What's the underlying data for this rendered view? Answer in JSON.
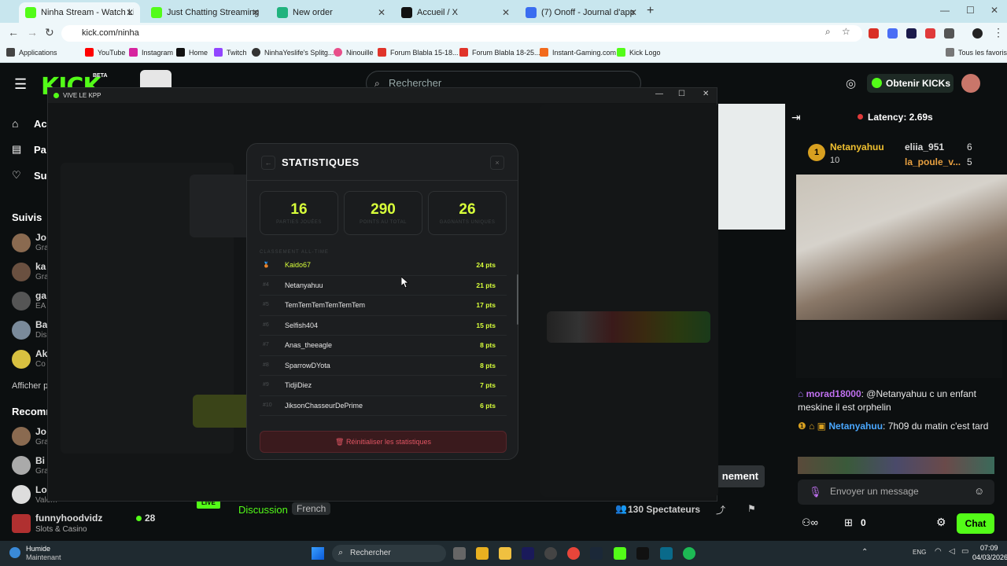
{
  "browser": {
    "tabs": [
      {
        "label": "Ninha Stream - Watch Live on K",
        "color": "#53fc18"
      },
      {
        "label": "Just Chatting Streaming - Live S",
        "color": "#53fc18"
      },
      {
        "label": "New order",
        "color": "#21b37e"
      },
      {
        "label": "Accueil / X",
        "color": "#111111"
      },
      {
        "label": "(7) Onoff - Journal d'appel",
        "color": "#3a6df0"
      }
    ],
    "url": "kick.com/ninha",
    "bookmarks": [
      "Applications",
      "YouTube",
      "Instagram",
      "Home",
      "Twitch",
      "NinhaYeslife's Splitg...",
      "Ninouille",
      "Forum Blabla 15-18...",
      "Forum Blabla 18-25...",
      "Instant-Gaming.com",
      "Kick Logo"
    ],
    "all_bookmarks": "Tous les favoris"
  },
  "kick": {
    "logo": "KICK",
    "beta": "BETA",
    "search_placeholder": "Rechercher",
    "kicks_button": "Obtenir KICKs",
    "sidebar": {
      "nav": [
        "Ac",
        "Pa",
        "Su"
      ],
      "follows_title": "Suivis",
      "follows": [
        {
          "name": "Jo",
          "sub": "Gra"
        },
        {
          "name": "ka",
          "sub": "Gra"
        },
        {
          "name": "ga",
          "sub": "EA"
        },
        {
          "name": "Ba",
          "sub": "Dis"
        },
        {
          "name": "Ak",
          "sub": "Co"
        }
      ],
      "show_more": "Afficher p",
      "recommended_title": "Recomm",
      "recommended": [
        {
          "name": "Jo",
          "sub": "Gra"
        },
        {
          "name": "Bi",
          "sub": "Gra"
        },
        {
          "name": "Lo",
          "sub": "Valem"
        }
      ],
      "streamer": {
        "name": "funnyhoodvidz",
        "sub": "Slots & Casino",
        "viewers": "28"
      }
    },
    "stream_bar": {
      "live": "LIVE",
      "category": "Discussion",
      "language": "French",
      "viewers": "130 Spectateurs",
      "subscribe_partial": "nement"
    }
  },
  "overlay_window": {
    "title": "VIVE LE KPP",
    "modal": {
      "title": "STATISTIQUES",
      "back": "←",
      "close": "×",
      "stats": [
        {
          "value": "16",
          "label": "PARTIES JOUÉES"
        },
        {
          "value": "290",
          "label": "POINTS AU TOTAL"
        },
        {
          "value": "26",
          "label": "GAGNANTS UNIQUES"
        }
      ],
      "leaderboard_title": "CLASSEMENT ALL-TIME",
      "leaderboard": [
        {
          "rank": "🥉",
          "name": "Kaido67",
          "pts": "24 pts"
        },
        {
          "rank": "#4",
          "name": "Netanyahuu",
          "pts": "21 pts"
        },
        {
          "rank": "#5",
          "name": "TemTemTemTemTemTem",
          "pts": "17 pts"
        },
        {
          "rank": "#6",
          "name": "Selfish404",
          "pts": "15 pts"
        },
        {
          "rank": "#7",
          "name": "Anas_theeagle",
          "pts": "8 pts"
        },
        {
          "rank": "#8",
          "name": "SparrowDYota",
          "pts": "8 pts"
        },
        {
          "rank": "#9",
          "name": "TidjiDiez",
          "pts": "7 pts"
        },
        {
          "rank": "#10",
          "name": "JiksonChasseurDePrime",
          "pts": "6 pts"
        }
      ],
      "reset_button": "Réinitialiser les statistiques"
    }
  },
  "chat": {
    "latency": "Latency: 2.69s",
    "leaders": [
      {
        "name": "Netanyahuu",
        "count": "10"
      },
      {
        "name": "eliia_951",
        "count": "6"
      },
      {
        "name": "la_poule_v...",
        "count": "5"
      }
    ],
    "messages": [
      {
        "user": "morad18000",
        "text": ": @Netanyahuu c un enfant meskine il est orphelin"
      },
      {
        "user": "Netanyahuu",
        "text": ": 7h09 du matin c'est tard"
      }
    ],
    "input_placeholder": "Envoyer un message",
    "points": "0",
    "chat_button": "Chat"
  },
  "taskbar": {
    "weather": "Humide",
    "weather_sub": "Maintenant",
    "search": "Rechercher",
    "lang": "ENG",
    "time": "07:09",
    "date": "04/03/2026"
  }
}
